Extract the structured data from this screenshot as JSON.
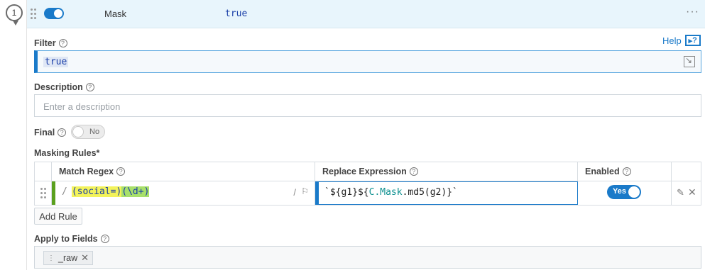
{
  "function": {
    "step": "1",
    "name": "Mask",
    "filter_preview": "true"
  },
  "help": {
    "label": "Help",
    "icon_glyph": "?"
  },
  "filter": {
    "label": "Filter",
    "value": "true"
  },
  "description": {
    "label": "Description",
    "placeholder": "Enter a description",
    "value": ""
  },
  "final": {
    "label": "Final",
    "toggle_text": "No"
  },
  "masking_rules": {
    "label": "Masking Rules*",
    "columns": [
      "Match Regex",
      "Replace Expression",
      "Enabled"
    ],
    "rows": [
      {
        "regex": {
          "open": "/",
          "group1": "(social=)",
          "group2": "(\\d+)",
          "close": "/"
        },
        "replace": {
          "prefix": "`${g1}${",
          "obj": "C.Mask",
          "suffix": ".md5(g2)}`"
        },
        "enabled_text": "Yes"
      }
    ],
    "add_label": "Add Rule"
  },
  "apply_fields": {
    "label": "Apply to Fields",
    "chips": [
      "_raw"
    ]
  },
  "colors": {
    "accent": "#1a7ac9",
    "header_bg": "#e8f5fc",
    "regex_group_yellow": "#f3f35a",
    "regex_group_green": "#a8e06a"
  }
}
